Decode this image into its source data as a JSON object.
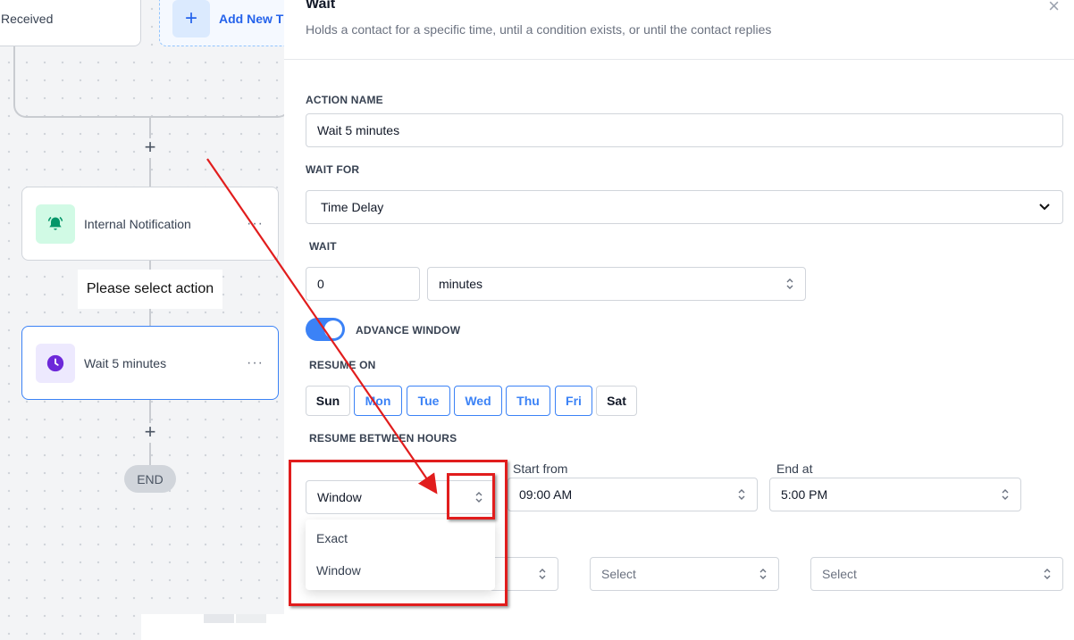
{
  "canvas": {
    "received_label": "Received",
    "add_new_label": "Add New T",
    "notification_label": "Internal Notification",
    "tooltip": "Please select action",
    "wait_label": "Wait 5 minutes",
    "end_label": "END"
  },
  "panel": {
    "title": "Wait",
    "subtitle": "Holds a contact for a specific time, until a condition exists, or until the contact replies",
    "action_name_label": "ACTION NAME",
    "action_name_value": "Wait 5 minutes",
    "wait_for_label": "WAIT FOR",
    "wait_for_value": "Time Delay",
    "wait_label": "WAIT",
    "wait_amount": "0",
    "wait_unit": "minutes",
    "advance_window_label": "ADVANCE WINDOW",
    "advance_window_on": true,
    "resume_on_label": "RESUME ON",
    "days": [
      {
        "label": "Sun",
        "active": false
      },
      {
        "label": "Mon",
        "active": true
      },
      {
        "label": "Tue",
        "active": true
      },
      {
        "label": "Wed",
        "active": true
      },
      {
        "label": "Thu",
        "active": true
      },
      {
        "label": "Fri",
        "active": true
      },
      {
        "label": "Sat",
        "active": false
      }
    ],
    "resume_between_label": "RESUME BETWEEN HOURS",
    "mode_value": "Window",
    "start_from_label": "Start from",
    "start_from_value": "09:00 AM",
    "end_at_label": "End at",
    "end_at_value": "5:00 PM",
    "mode_options": [
      "Exact",
      "Window"
    ],
    "select_placeholder": "Select"
  },
  "colors": {
    "accent": "#3b82f6",
    "annotation": "#e11d1d"
  }
}
